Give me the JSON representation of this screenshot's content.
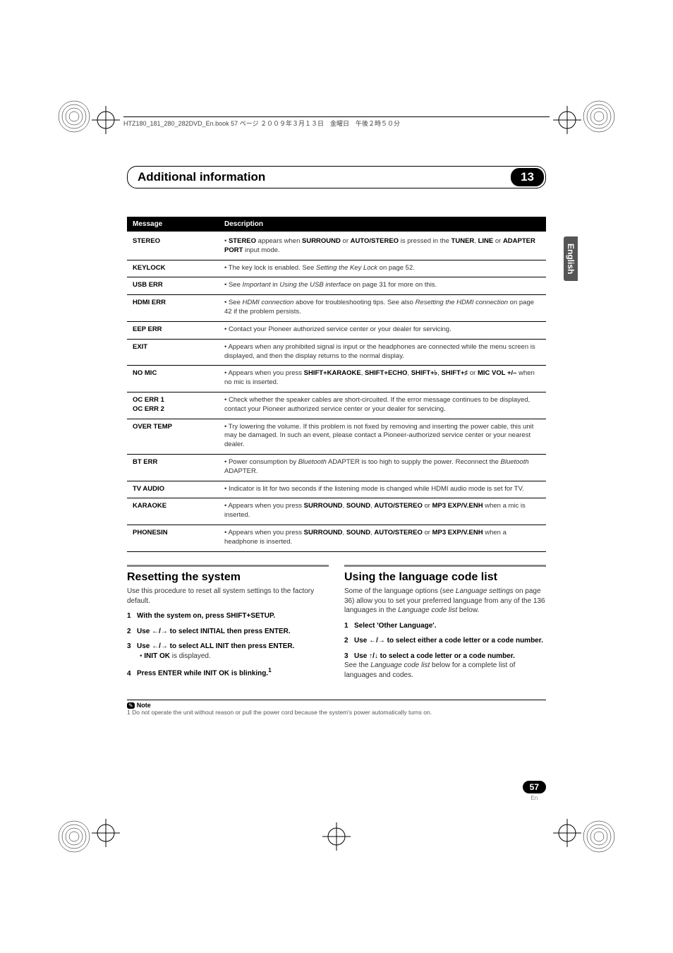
{
  "header_text": "HTZ180_181_280_282DVD_En.book  57 ページ  ２００９年３月１３日　金曜日　午後２時５０分",
  "chapter": {
    "title": "Additional information",
    "number": "13"
  },
  "lang_tab": "English",
  "table": {
    "headers": {
      "col1": "Message",
      "col2": "Description"
    },
    "rows": [
      {
        "msg": "STEREO",
        "desc_html": "• <b>STEREO</b> appears when <b>SURROUND</b> or <b>AUTO/STEREO</b> is pressed in the <b>TUNER</b>, <b>LINE</b> or <b>ADAPTER PORT</b> input mode."
      },
      {
        "msg": "KEYLOCK",
        "desc_html": "• The key lock is enabled. See <span class='italic'>Setting the Key Lock</span> on page 52."
      },
      {
        "msg": "USB ERR",
        "desc_html": "• See <span class='italic'>Important</span> in <span class='italic'>Using the USB interface</span> on page 31 for more on this."
      },
      {
        "msg": "HDMI ERR",
        "desc_html": "• See <span class='italic'>HDMI connection</span> above for troubleshooting tips. See also <span class='italic'>Resetting the HDMI connection</span> on page 42 if the problem persists."
      },
      {
        "msg": "EEP ERR",
        "desc_html": "• Contact your Pioneer authorized service center or your dealer for servicing."
      },
      {
        "msg": "EXIT",
        "desc_html": "• Appears when any prohibited signal is input or the headphones are connected while the menu screen is displayed, and then the display returns to the normal display."
      },
      {
        "msg": "NO MIC",
        "desc_html": "• Appears when you press <b>SHIFT+KARAOKE</b>, <b>SHIFT+ECHO</b>, <b>SHIFT+♭</b>, <b>SHIFT+♯</b> or <b>MIC VOL +/–</b> when no mic is inserted."
      },
      {
        "msg": "OC ERR 1\nOC ERR 2",
        "desc_html": "• Check whether the speaker cables are short-circuited. If the error message continues to be displayed, contact your Pioneer authorized service center or your dealer for servicing."
      },
      {
        "msg": "OVER TEMP",
        "desc_html": "• Try lowering the volume. If this problem is not fixed by removing and inserting the power cable, this unit may be damaged. In such an event, please contact a Pioneer-authorized service center or your nearest dealer."
      },
      {
        "msg": "BT ERR",
        "desc_html": "• Power consumption by <span class='italic'>Bluetooth</span> ADAPTER is too high to supply the power. Reconnect the <span class='italic'>Bluetooth</span> ADAPTER."
      },
      {
        "msg": "TV AUDIO",
        "desc_html": "• Indicator is lit for two seconds if the listening mode is changed while HDMI audio mode is set for TV."
      },
      {
        "msg": "KARAOKE",
        "desc_html": "• Appears when you press <b>SURROUND</b>, <b>SOUND</b>, <b>AUTO/STEREO</b> or <b>MP3 EXP/V.ENH</b> when a mic is inserted."
      },
      {
        "msg": "PHONESIN",
        "desc_html": "• Appears when you press <b>SURROUND</b>, <b>SOUND</b>, <b>AUTO/STEREO</b> or <b>MP3 EXP/V.ENH</b> when a headphone is inserted."
      }
    ]
  },
  "left_col": {
    "heading": "Resetting the system",
    "intro": "Use this procedure to reset all system settings to the factory default.",
    "steps": [
      {
        "num": "1",
        "text": "With the system on, press SHIFT+SETUP."
      },
      {
        "num": "2",
        "text_html": "Use <span class='arrow'>←/→</span> to select INITIAL then press ENTER."
      },
      {
        "num": "3",
        "text_html": "Use <span class='arrow'>←/→</span> to select ALL INIT then press ENTER.",
        "sub_html": "• <b>INIT OK</b> is displayed."
      },
      {
        "num": "4",
        "text_html": "Press ENTER while INIT OK is blinking.<sup>1</sup>"
      }
    ]
  },
  "right_col": {
    "heading": "Using the language code list",
    "intro_html": "Some of the language options (see <span class='italic'>Language settings</span> on page 36) allow you to set your preferred language from any of the 136 languages in the <span class='italic'>Language code list</span> below.",
    "steps": [
      {
        "num": "1",
        "text": "Select 'Other Language'."
      },
      {
        "num": "2",
        "text_html": "Use <span class='arrow'>←/→</span> to select either a code letter or a code number."
      },
      {
        "num": "3",
        "text_html": "Use <span class='arrow'>↑/↓</span> to select a code letter or a code number.",
        "after_html": "See the <span class='italic'>Language code list</span> below for a complete list of languages and codes."
      }
    ]
  },
  "note": {
    "label": "Note",
    "text": "1 Do not operate the unit without reason or pull the power cord because the system's power automatically turns on."
  },
  "page": {
    "number": "57",
    "lang": "En"
  }
}
